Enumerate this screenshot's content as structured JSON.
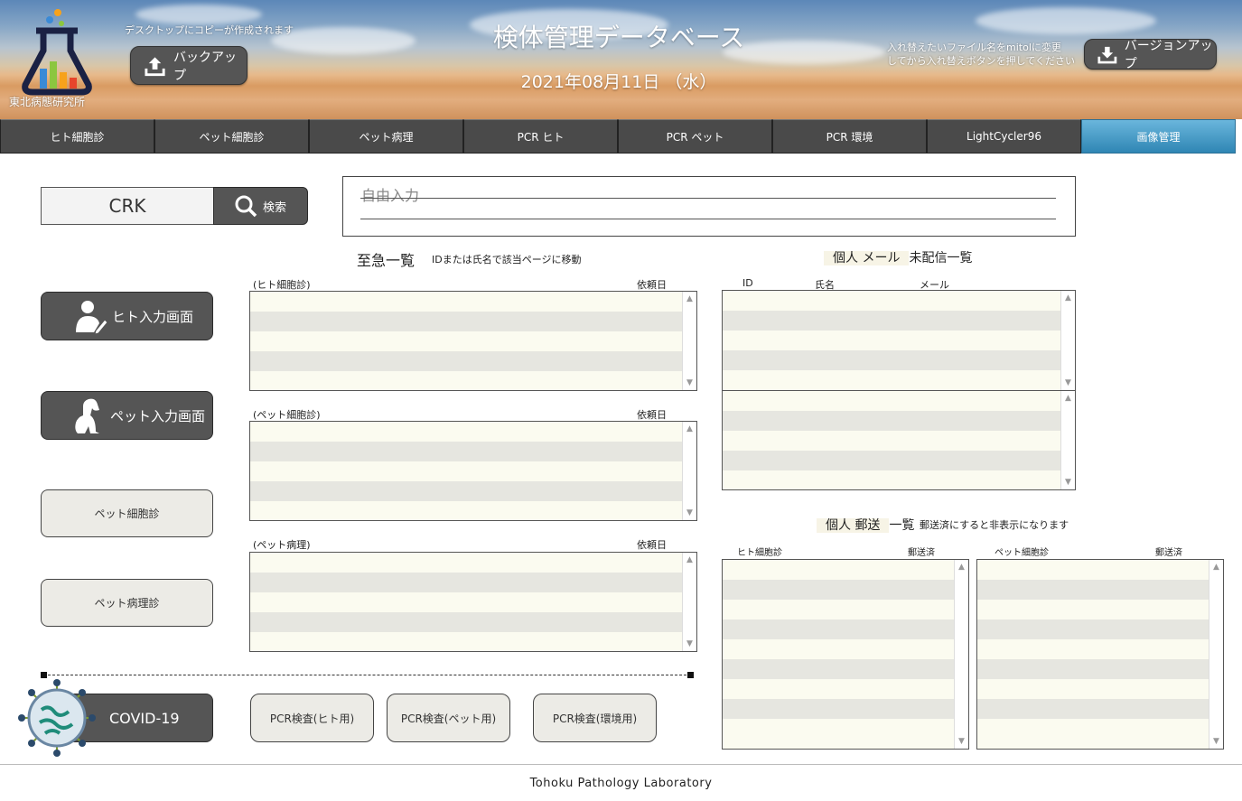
{
  "header": {
    "logo_text": "東北病態研究所",
    "desktop_note": "デスクトップにコピーが作成されます",
    "backup_label": "バックアップ",
    "title": "検体管理データベース",
    "date": "2021年08月11日 （水）",
    "replace_note_1": "入れ替えたいファイル名をmitolに変更",
    "replace_note_2": "してから入れ替えボタンを押してください",
    "version_label": "バージョンアップ"
  },
  "nav": {
    "tabs": [
      {
        "label": "ヒト細胞診"
      },
      {
        "label": "ペット細胞診"
      },
      {
        "label": "ペット病理"
      },
      {
        "label": "PCR ヒト"
      },
      {
        "label": "PCR ペット"
      },
      {
        "label": "PCR 環境"
      },
      {
        "label": "LightCycler96"
      },
      {
        "label": "画像管理",
        "active": true
      }
    ]
  },
  "search": {
    "value": "CRK",
    "button_label": "検索"
  },
  "free_input": {
    "placeholder": "自由入力"
  },
  "left_buttons": {
    "human_input": "ヒト入力画面",
    "pet_input": "ペット入力画面",
    "pet_cyto": "ペット細胞診",
    "pet_patho": "ペット病理診",
    "covid": "COVID-19"
  },
  "pcr_buttons": [
    "PCR検査(ヒト用)",
    "PCR検査(ペット用)",
    "PCR検査(環境用)"
  ],
  "urgent": {
    "title": "至急一覧",
    "hint": "IDまたは氏名で該当ページに移動",
    "lists": [
      {
        "label": "(ヒト細胞診)",
        "date_label": "依頼日"
      },
      {
        "label": "(ペット細胞診)",
        "date_label": "依頼日"
      },
      {
        "label": "(ペット病理)",
        "date_label": "依頼日"
      }
    ]
  },
  "mail": {
    "title_highlight": "個人 メール",
    "title_rest": "未配信一覧",
    "col_id": "ID",
    "col_name": "氏名",
    "col_mail": "メール"
  },
  "post": {
    "title_highlight": "個人 郵送",
    "title_rest": "一覧",
    "hint": "郵送済にすると非表示になります",
    "left_label": "ヒト細胞診",
    "left_sent": "郵送済",
    "right_label": "ペット細胞診",
    "right_sent": "郵送済"
  },
  "footer": {
    "text": "Tohoku Pathology Laboratory"
  },
  "colors": {
    "dark_button": "#555555",
    "active_tab": "#2f86b4",
    "list_bg": "#fbfbf0"
  }
}
